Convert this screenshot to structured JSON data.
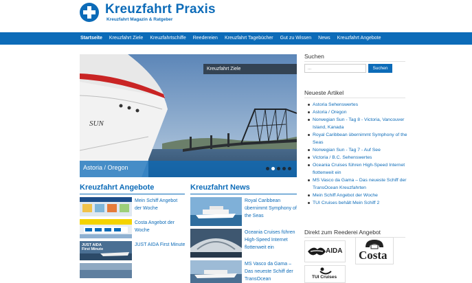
{
  "header": {
    "site_title": "Kreuzfahrt Praxis",
    "tagline": "Kreuzfahrt Magazin & Ratgeber"
  },
  "nav": {
    "items": [
      "Startseite",
      "Kreuzfahrt Ziele",
      "Kreuzfahrtschiffe",
      "Reedereien",
      "Kreuzfahrt Tagebücher",
      "Gut zu Wissen",
      "News",
      "Kreuzfahrt Angebote"
    ],
    "active": "Startseite"
  },
  "slider": {
    "category": "Kreuzfahrt Ziele",
    "caption": "Astoria / Oregon",
    "slide_count": 5,
    "active_slide": 2,
    "ship_lettering": "SUN"
  },
  "angebote": {
    "title": "Kreuzfahrt Angebote",
    "items": [
      {
        "title": "Mein Schiff Angebot der Woche"
      },
      {
        "title": "Costa Angebot der Woche"
      },
      {
        "title": "JUST AIDA First Minute",
        "thumb_text": "JUST AIDA First Minute"
      }
    ]
  },
  "news": {
    "title": "Kreuzfahrt News",
    "items": [
      {
        "title": "Royal Caribbean übernimmt Symphony of the Seas"
      },
      {
        "title": "Oceania Cruises führen High-Speed Internet flottenweit ein"
      },
      {
        "title": "MS Vasco da Gama – Das neueste Schiff der TransOcean"
      }
    ]
  },
  "sidebar": {
    "search": {
      "title": "Suchen",
      "placeholder": "...",
      "button": "Suchen"
    },
    "recent": {
      "title": "Neueste Artikel",
      "items": [
        "Astoria Sehenswertes",
        "Astoria / Oregon",
        "Norwegian Sun - Tag 8 - Victoria, Vancouver Island, Kanada",
        "Royal Caribbean übernimmt Symphony of the Seas",
        "Norwegian Sun - Tag 7 - Auf See",
        "Victoria / B.C. Sehenswertes",
        "Oceania Cruises führen High-Speed Internet flottenweit ein",
        "MS Vasco da Gama – Das neueste Schiff der TransOcean Kreuzfahrten",
        "Mein Schiff Angebot der Woche",
        "TUI Cruises behält Mein Schiff 2"
      ]
    },
    "direct": {
      "title": "Direkt zum Reederei Angebot",
      "brands": [
        "AIDA",
        "Costa",
        "TUI Cruises"
      ]
    }
  }
}
